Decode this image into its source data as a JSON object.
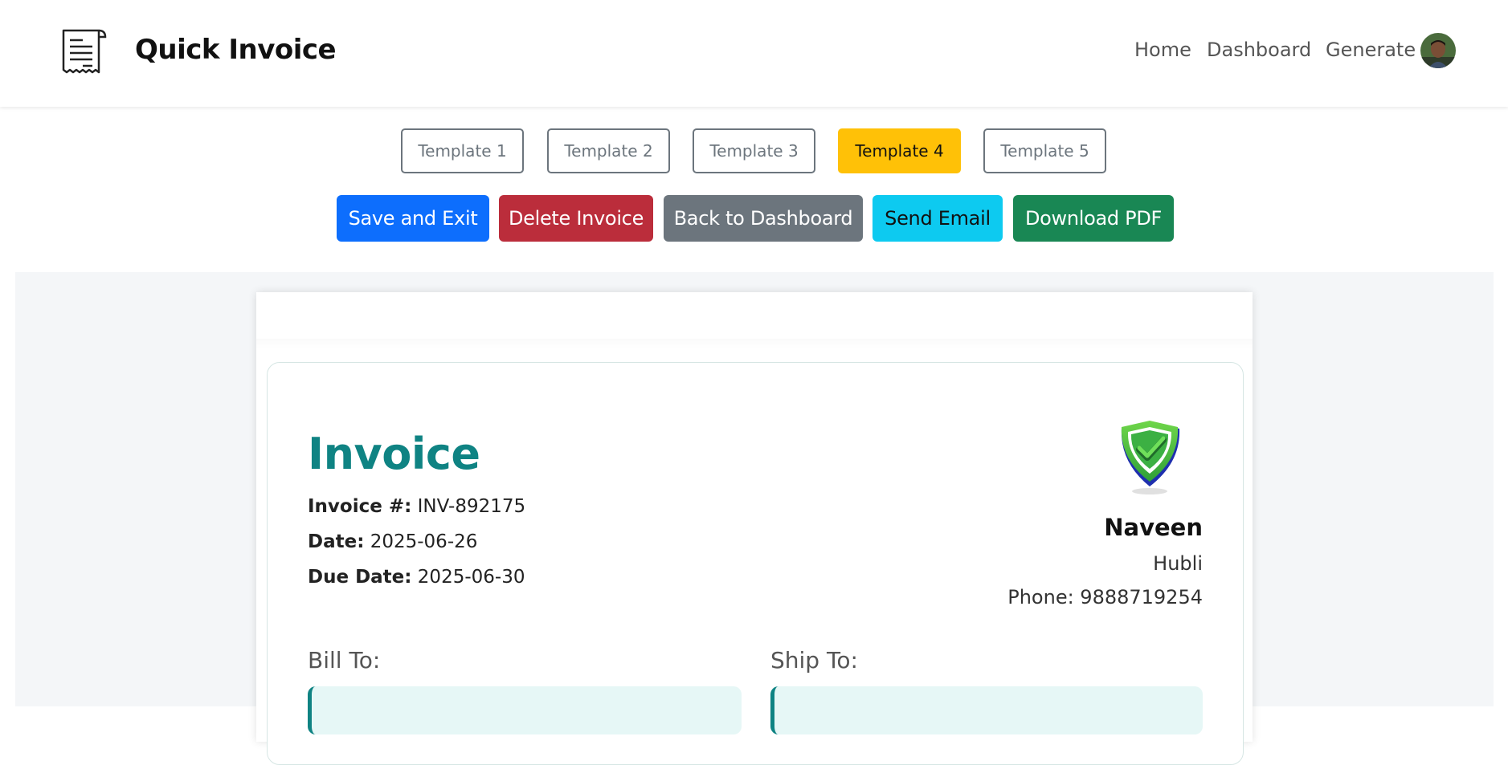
{
  "navbar": {
    "brand": "Quick Invoice",
    "links": [
      "Home",
      "Dashboard",
      "Generate"
    ]
  },
  "templates": {
    "items": [
      "Template 1",
      "Template 2",
      "Template 3",
      "Template 4",
      "Template 5"
    ],
    "active_index": 3
  },
  "actions": {
    "save": "Save and Exit",
    "delete": "Delete Invoice",
    "back": "Back to Dashboard",
    "email": "Send Email",
    "download": "Download PDF"
  },
  "colors": {
    "primary": "#0d6efd",
    "danger": "#bb2d3b",
    "secondary": "#6c757d",
    "info": "#0dcaf0",
    "success": "#198754",
    "warning": "#ffc107",
    "accent_teal": "#0f8383"
  },
  "invoice": {
    "title": "Invoice",
    "number_label": "Invoice #:",
    "number": "INV-892175",
    "date_label": "Date:",
    "date": "2025-06-26",
    "due_label": "Due Date:",
    "due_date": "2025-06-30",
    "company_name": "Naveen",
    "company_address": "Hubli",
    "company_phone": "Phone: 9888719254",
    "bill_to_label": "Bill To:",
    "ship_to_label": "Ship To:"
  }
}
